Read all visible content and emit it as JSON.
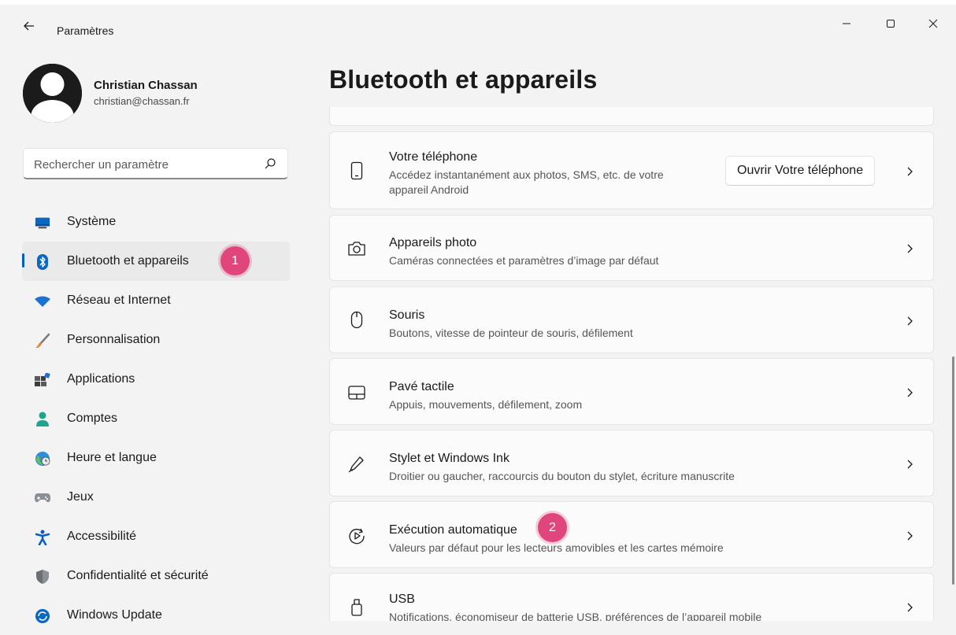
{
  "window": {
    "title": "Paramètres"
  },
  "user": {
    "name": "Christian Chassan",
    "email": "christian@chassan.fr"
  },
  "search": {
    "placeholder": "Rechercher un paramètre"
  },
  "sidebar": {
    "items": [
      {
        "label": "Système",
        "icon": "monitor-icon"
      },
      {
        "label": "Bluetooth et appareils",
        "icon": "bluetooth-icon",
        "selected": true
      },
      {
        "label": "Réseau et Internet",
        "icon": "wifi-icon"
      },
      {
        "label": "Personnalisation",
        "icon": "brush-icon"
      },
      {
        "label": "Applications",
        "icon": "apps-icon"
      },
      {
        "label": "Comptes",
        "icon": "person-icon"
      },
      {
        "label": "Heure et langue",
        "icon": "globe-clock-icon"
      },
      {
        "label": "Jeux",
        "icon": "gamepad-icon"
      },
      {
        "label": "Accessibilité",
        "icon": "accessibility-icon"
      },
      {
        "label": "Confidentialité et sécurité",
        "icon": "shield-icon"
      },
      {
        "label": "Windows Update",
        "icon": "update-icon"
      }
    ]
  },
  "badges": {
    "one": "1",
    "two": "2"
  },
  "main": {
    "title": "Bluetooth et appareils",
    "cards": [
      {
        "title": "Votre téléphone",
        "desc_line1": "Accédez instantanément aux photos, SMS, etc. de votre",
        "desc_line2": "appareil Android",
        "action": "Ouvrir Votre téléphone",
        "icon": "phone-icon"
      },
      {
        "title": "Appareils photo",
        "desc": "Caméras connectées et paramètres d’image par défaut",
        "icon": "camera-icon"
      },
      {
        "title": "Souris",
        "desc": "Boutons, vitesse de pointeur de souris, défilement",
        "icon": "mouse-icon"
      },
      {
        "title": "Pavé tactile",
        "desc": "Appuis, mouvements, défilement, zoom",
        "icon": "touchpad-icon"
      },
      {
        "title": "Stylet et Windows Ink",
        "desc": "Droitier ou gaucher, raccourcis du bouton du stylet, écriture manuscrite",
        "icon": "pen-icon"
      },
      {
        "title": "Exécution automatique",
        "desc": "Valeurs par défaut pour les lecteurs amovibles et les cartes mémoire",
        "icon": "autoplay-icon"
      },
      {
        "title": "USB",
        "desc": "Notifications, économiseur de batterie USB, préférences de l’appareil mobile",
        "icon": "usb-icon"
      }
    ]
  },
  "colors": {
    "accent": "#005fb8",
    "badge": "#e0457b",
    "background": "#f3f3f3",
    "card": "#fbfbfb"
  }
}
